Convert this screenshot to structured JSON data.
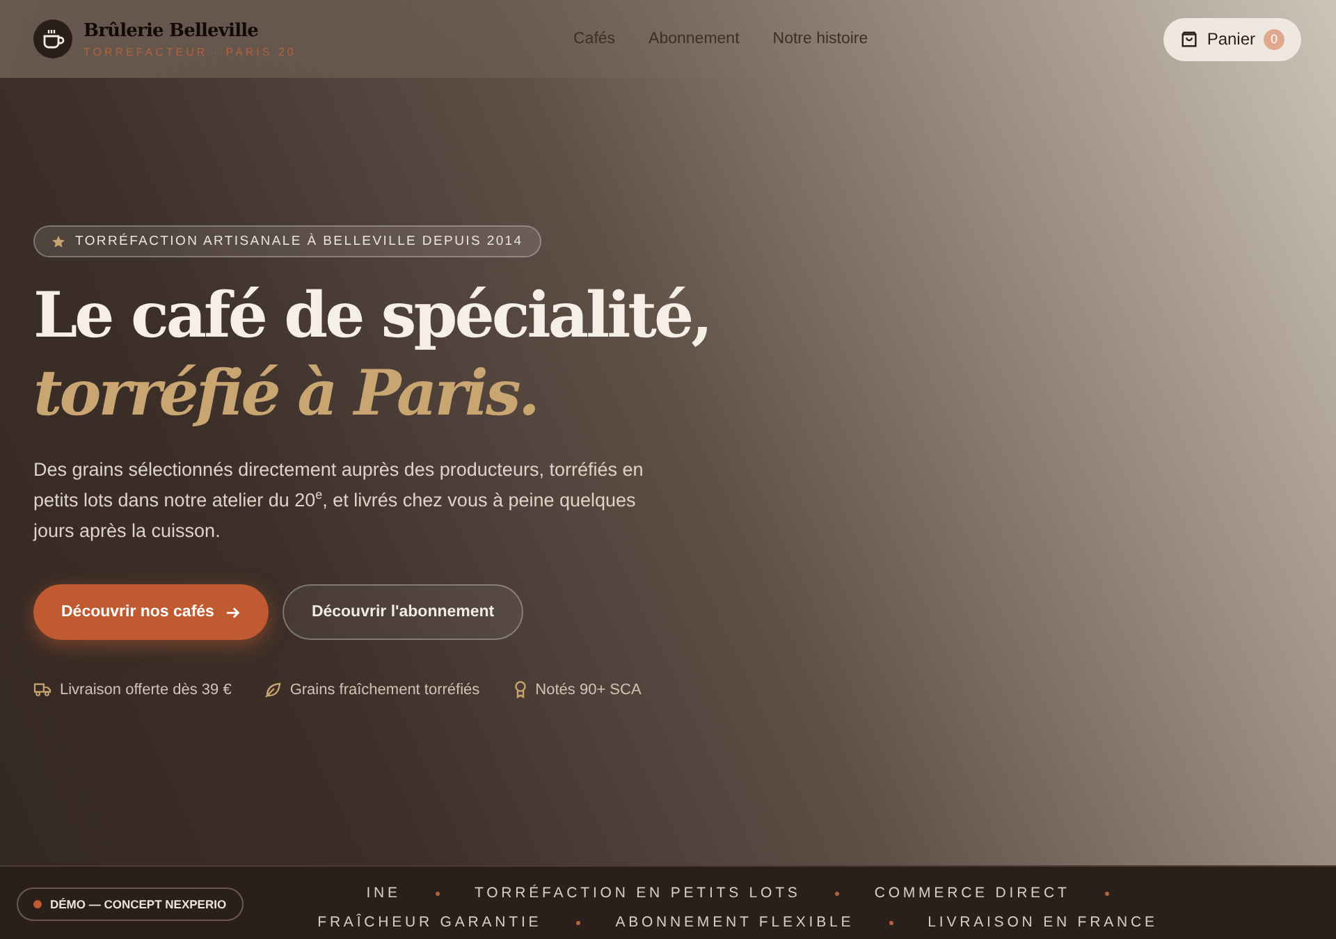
{
  "header": {
    "brand": "Brûlerie Belleville",
    "tagline": "TORREFACTEUR · PARIS 20",
    "nav": [
      {
        "label": "Cafés"
      },
      {
        "label": "Abonnement"
      },
      {
        "label": "Notre histoire"
      }
    ],
    "cart": {
      "label": "Panier",
      "count": "0"
    }
  },
  "hero": {
    "badge": "TORRÉFACTION ARTISANALE À BELLEVILLE DEPUIS 2014",
    "title_line1": "Le café de spécialité,",
    "title_line2": "torréfié à Paris.",
    "description": "Des grains sélectionnés directement auprès des producteurs, torréfiés en petits lots dans notre atelier du 20$^{e}$, et livrés chez vous à peine quelques jours après la cuisson.",
    "buttons": [
      {
        "label": "Découvrir nos cafés",
        "kind": "primary"
      },
      {
        "label": "Découvrir l'abonnement",
        "kind": "secondary"
      }
    ],
    "features": [
      {
        "label": "Livraison offerte dès 39 €",
        "kind": "truck"
      },
      {
        "label": "Grains fraîchement torréfiés",
        "kind": "leaf"
      },
      {
        "label": "Notés 90+ SCA",
        "kind": "award"
      }
    ]
  },
  "ticker": {
    "items": [
      "INE",
      "TORRÉFACTION EN PETITS LOTS",
      "COMMERCE DIRECT",
      "FRAÎCHEUR GARANTIE",
      "ABONNEMENT FLEXIBLE",
      "LIVRAISON EN FRANCE"
    ]
  },
  "demo_badge": "DÉMO — CONCEPT NEXPERIO"
}
